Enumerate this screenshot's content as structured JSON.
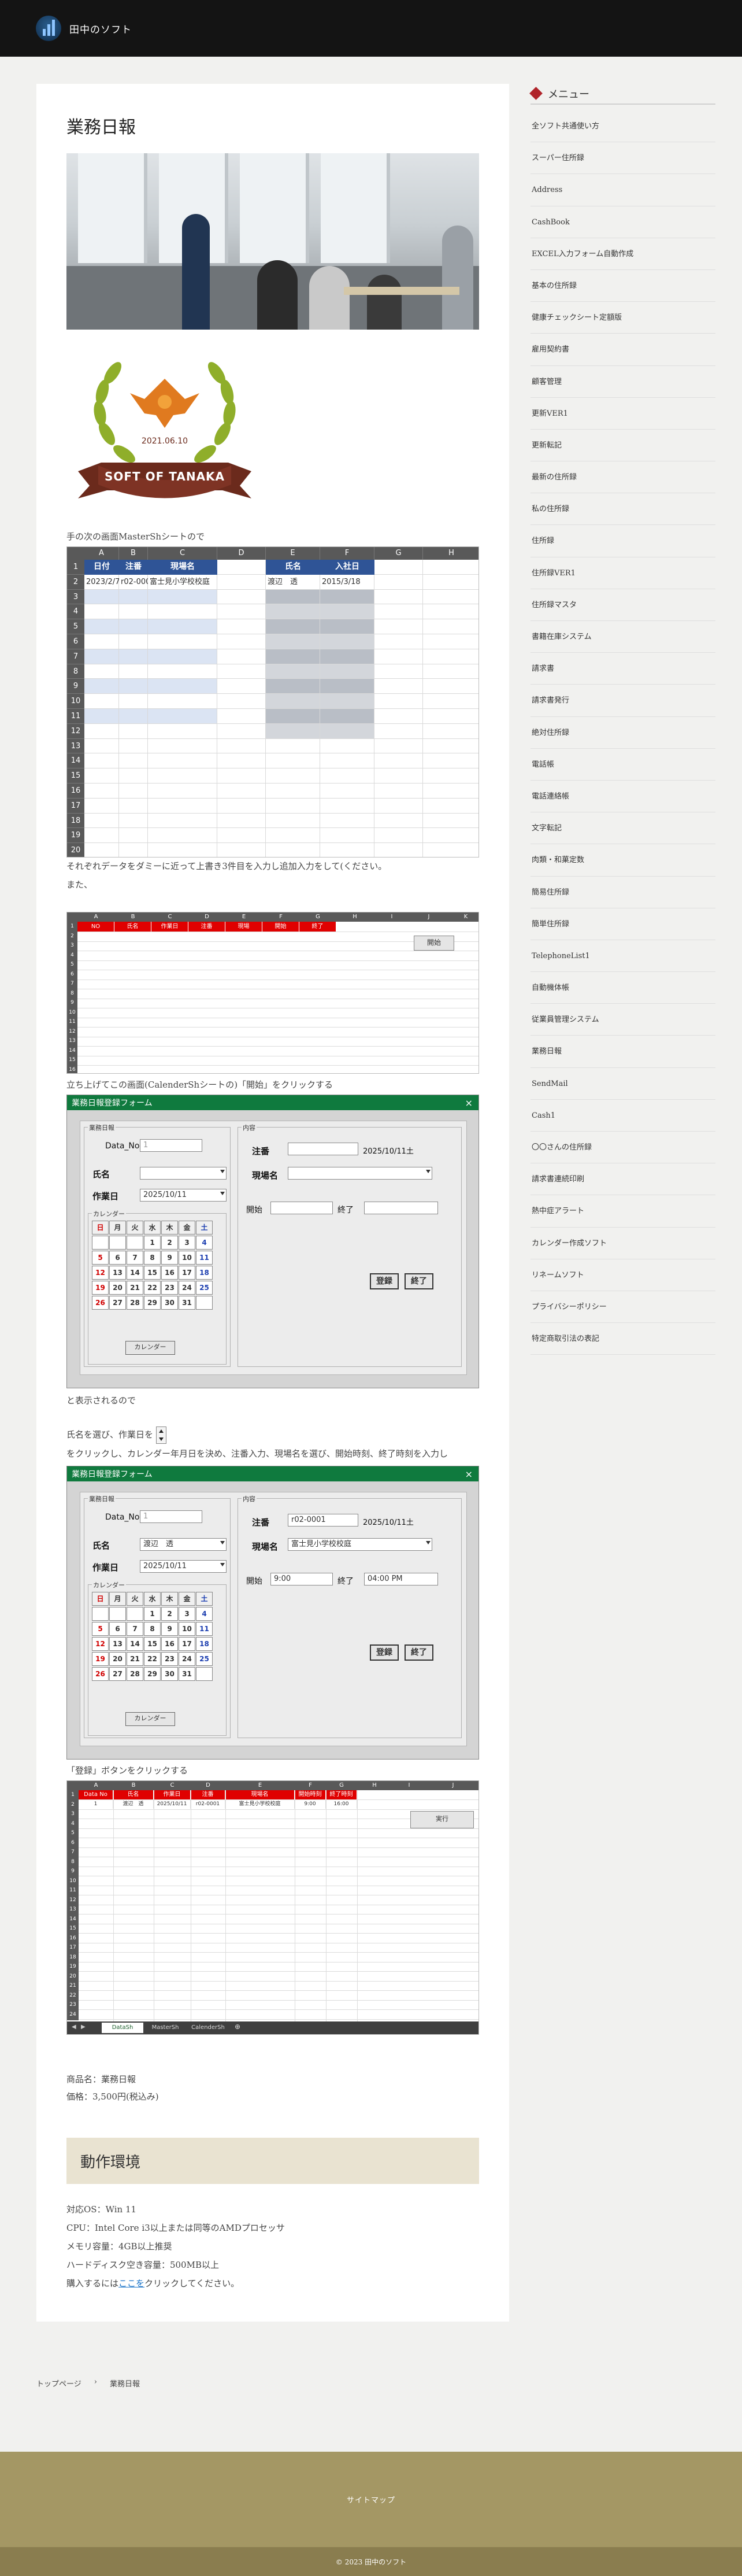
{
  "site": {
    "title": "田中のソフト"
  },
  "article": {
    "title": "業務日報",
    "badge_date": "2021.06.10",
    "badge_text": "SOFT OF TANAKA",
    "p1": "手の次の画面MasterShシートので",
    "p2a": "それぞれデータをダミーに近って上書き3件目を入力し追加入力をして(ください。",
    "p2b": "また、",
    "p3": "立ち上げてこの画面(CalenderShシートの)「開始」をクリックする",
    "p4": "と表示されるので",
    "p5": "氏名を選び、作業日を",
    "p6": "をクリックし、カレンダー年月日を決め、注番入力、現場名を選び、開始時刻、終了時刻を入力し",
    "p7": "「登録」ボタンをクリックする",
    "product_name": "商品名：業務日報",
    "price": "価格：3,500円(税込み)",
    "env_title": "動作環境",
    "env": [
      "対応OS：Win 11",
      "CPU：Intel Core i3以上または同等のAMDプロセッサ",
      "メモリ容量：4GB以上推奨",
      "ハードディスク空き容量：500MB以上"
    ],
    "buy_prefix": "購入するには",
    "buy_link": "ここを",
    "buy_suffix": "クリックしてください。"
  },
  "sheet1": {
    "cols": [
      "A",
      "B",
      "C",
      "D",
      "E",
      "F",
      "G",
      "H"
    ],
    "rows": [
      "1",
      "2",
      "3",
      "4",
      "5",
      "6",
      "7",
      "8",
      "9",
      "10",
      "11",
      "12",
      "13",
      "14",
      "15",
      "16",
      "17",
      "18",
      "19",
      "20"
    ],
    "hdr_left": [
      "日付",
      "注番",
      "現場名"
    ],
    "hdr_right": [
      "氏名",
      "入社日"
    ],
    "r2": [
      "2023/2/7",
      "r02-0001",
      "富士見小学校校庭"
    ],
    "r2_right": [
      "渡辺　透",
      "2015/3/18"
    ]
  },
  "sheet2": {
    "cols": [
      "A",
      "B",
      "C",
      "D",
      "E",
      "F",
      "G",
      "H",
      "I",
      "J",
      "K"
    ],
    "hdrs": [
      "NO",
      "氏名",
      "作業日",
      "注番",
      "現場",
      "開始",
      "終了"
    ],
    "start_btn": "開始"
  },
  "form1": {
    "title": "業務日報登録フォーム",
    "close": "×",
    "frame_a": "業務日報",
    "frame_b": "内容",
    "frame_cal": "カレンダー",
    "data_no_label": "Data_No",
    "data_no_value": "1",
    "name_label": "氏名",
    "name_value": "",
    "date_label": "作業日",
    "date_value": "2025/10/11",
    "order_label": "注番",
    "order_value": "",
    "site_date": "2025/10/11土",
    "site_label": "現場名",
    "site_value": "",
    "start_label": "開始",
    "start_value": "",
    "end_label": "終了",
    "end_value": "",
    "register": "登録",
    "finish": "終了",
    "cal_button": "カレンダー"
  },
  "form2": {
    "title": "業務日報登録フォーム",
    "close": "×",
    "frame_a": "業務日報",
    "frame_b": "内容",
    "frame_cal": "カレンダー",
    "data_no_label": "Data_No",
    "data_no_value": "1",
    "name_label": "氏名",
    "name_value": "渡辺　透",
    "date_label": "作業日",
    "date_value": "2025/10/11",
    "order_label": "注番",
    "order_value": "r02-0001",
    "site_date": "2025/10/11土",
    "site_label": "現場名",
    "site_value": "富士見小学校校庭",
    "start_label": "開始",
    "start_value": "9:00",
    "end_label": "終了",
    "end_value": "04:00 PM",
    "register": "登録",
    "finish": "終了",
    "cal_button": "カレンダー"
  },
  "calendar": {
    "weekdays": [
      "日",
      "月",
      "火",
      "水",
      "木",
      "金",
      "土"
    ],
    "weeks": [
      [
        "",
        "",
        "",
        "1",
        "2",
        "3",
        "4"
      ],
      [
        "5",
        "6",
        "7",
        "8",
        "9",
        "10",
        "11"
      ],
      [
        "12",
        "13",
        "14",
        "15",
        "16",
        "17",
        "18"
      ],
      [
        "19",
        "20",
        "21",
        "22",
        "23",
        "24",
        "25"
      ],
      [
        "26",
        "27",
        "28",
        "29",
        "30",
        "31",
        ""
      ]
    ]
  },
  "sheet3": {
    "cols": [
      "A",
      "B",
      "C",
      "D",
      "E",
      "F",
      "G",
      "H",
      "I",
      "J"
    ],
    "hdrs": [
      "Data No",
      "氏名",
      "作業日",
      "注番",
      "現場名",
      "開始時刻",
      "終了時刻"
    ],
    "r2": [
      "1",
      "渡辺　透",
      "2025/10/11",
      "r02-0001",
      "富士見小学校校庭",
      "9:00",
      "16:00"
    ],
    "btn": "実行",
    "tabs": [
      "DataSh",
      "MasterSh",
      "CalenderSh"
    ]
  },
  "sidebar": {
    "heading": "メニュー",
    "items": [
      "全ソフト共通使い方",
      "スーパー住所録",
      "Address",
      "CashBook",
      "EXCEL入力フォーム自動作成",
      "基本の住所録",
      "健康チェックシート定額版",
      "雇用契約書",
      "顧客管理",
      "更新VER1",
      "更新転記",
      "最新の住所録",
      "私の住所録",
      "住所録",
      "住所録VER1",
      "住所録マスタ",
      "書籍在庫システム",
      "請求書",
      "請求書発行",
      "絶対住所録",
      "電話帳",
      "電話連絡帳",
      "文字転記",
      "肉類・和菓定数",
      "簡易住所録",
      "簡単住所録",
      "TelephoneList1",
      "自動機体帳",
      "従業員管理システム",
      "業務日報",
      "SendMail",
      "Cash1",
      "〇〇さんの住所録",
      "請求書連続印刷",
      "熱中症アラート",
      "カレンダー作成ソフト",
      "リネームソフト",
      "プライバシーポリシー",
      "特定商取引法の表記"
    ]
  },
  "breadcrumb": {
    "home": "トップページ",
    "sep": "›",
    "current": "業務日報"
  },
  "footer": {
    "sitemap": "サイトマップ",
    "copyright": "© 2023 田中のソフト"
  },
  "colors": {
    "header": "#141414",
    "form_title": "#0f7a3e",
    "footer": "#a49764",
    "accent": "#b0242a"
  }
}
